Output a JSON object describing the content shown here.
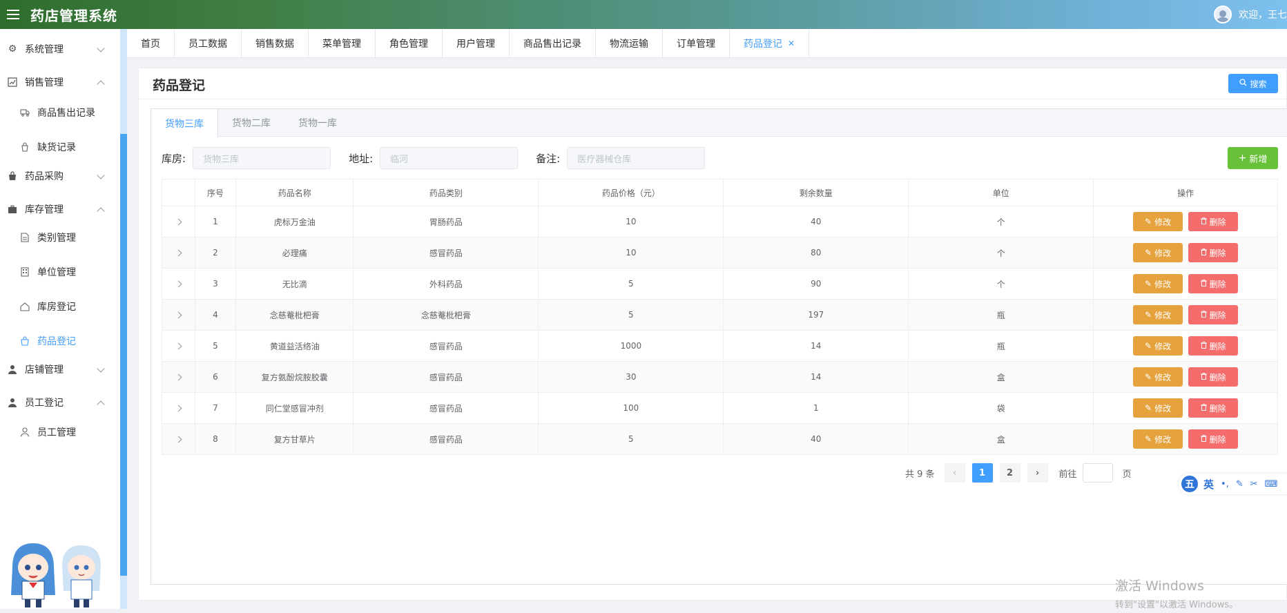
{
  "header": {
    "title": "药店管理系统",
    "welcome": "欢迎，王七"
  },
  "sidebar": {
    "menus": [
      {
        "label": "系统管理",
        "icon": "gear-icon",
        "expanded": false
      },
      {
        "label": "销售管理",
        "icon": "trend-icon",
        "expanded": true
      },
      {
        "label": "药品采购",
        "icon": "bag-icon",
        "expanded": false
      },
      {
        "label": "库存管理",
        "icon": "briefcase-icon",
        "expanded": true
      },
      {
        "label": "店铺管理",
        "icon": "user-icon",
        "expanded": false
      },
      {
        "label": "员工登记",
        "icon": "user-icon",
        "expanded": true
      }
    ],
    "subs": [
      {
        "label": "商品售出记录",
        "icon": "truck-icon"
      },
      {
        "label": "缺货记录",
        "icon": "cart-icon"
      },
      {
        "label": "类别管理",
        "icon": "document-icon"
      },
      {
        "label": "单位管理",
        "icon": "building-icon"
      },
      {
        "label": "库房登记",
        "icon": "house-icon"
      },
      {
        "label": "药品登记",
        "icon": "shop-icon",
        "active": true
      },
      {
        "label": "员工管理",
        "icon": "user-outline-icon"
      }
    ]
  },
  "tabs": [
    "首页",
    "员工数据",
    "销售数据",
    "菜单管理",
    "角色管理",
    "用户管理",
    "商品售出记录",
    "物流运输",
    "订单管理",
    "药品登记"
  ],
  "page": {
    "title": "药品登记",
    "search_label": "搜索",
    "add_label": "新增",
    "store_tabs": [
      "货物三库",
      "货物二库",
      "货物一库"
    ],
    "filters": {
      "warehouse_label": "库房:",
      "warehouse_value": "货物三库",
      "address_label": "地址:",
      "address_value": "临河",
      "remark_label": "备注:",
      "remark_value": "医疗器械仓库"
    }
  },
  "table": {
    "headers": [
      "",
      "序号",
      "药品名称",
      "药品类别",
      "药品价格（元）",
      "剩余数量",
      "单位",
      "操作"
    ],
    "edit_label": "修改",
    "delete_label": "删除",
    "rows": [
      {
        "no": "1",
        "name": "虎标万金油",
        "category": "胃肠药品",
        "price": "10",
        "qty": "40",
        "unit": "个"
      },
      {
        "no": "2",
        "name": "必理痛",
        "category": "感冒药品",
        "price": "10",
        "qty": "80",
        "unit": "个"
      },
      {
        "no": "3",
        "name": "无比滴",
        "category": "外科药品",
        "price": "5",
        "qty": "90",
        "unit": "个"
      },
      {
        "no": "4",
        "name": "念慈菴枇杷膏",
        "category": "念慈菴枇杷膏",
        "price": "5",
        "qty": "197",
        "unit": "瓶"
      },
      {
        "no": "5",
        "name": "黄道益活络油",
        "category": "感冒药品",
        "price": "1000",
        "qty": "14",
        "unit": "瓶"
      },
      {
        "no": "6",
        "name": "复方氨酚烷胺胶囊",
        "category": "感冒药品",
        "price": "30",
        "qty": "14",
        "unit": "盒"
      },
      {
        "no": "7",
        "name": "同仁堂感冒冲剂",
        "category": "感冒药品",
        "price": "100",
        "qty": "1",
        "unit": "袋"
      },
      {
        "no": "8",
        "name": "复方甘草片",
        "category": "感冒药品",
        "price": "5",
        "qty": "40",
        "unit": "盒"
      }
    ]
  },
  "pagination": {
    "total": "共 9 条",
    "pages": [
      "1",
      "2"
    ],
    "current": "1",
    "goto": "前往",
    "goto_suffix": "页"
  },
  "ime": {
    "logo": "五",
    "lang": "英"
  },
  "watermark": {
    "title": "激活 Windows",
    "sub": "转到\"设置\"以激活 Windows。"
  },
  "colors": {
    "primary": "#409eff",
    "success": "#67c23a",
    "warning": "#e6a23c",
    "danger": "#f56c6c"
  }
}
